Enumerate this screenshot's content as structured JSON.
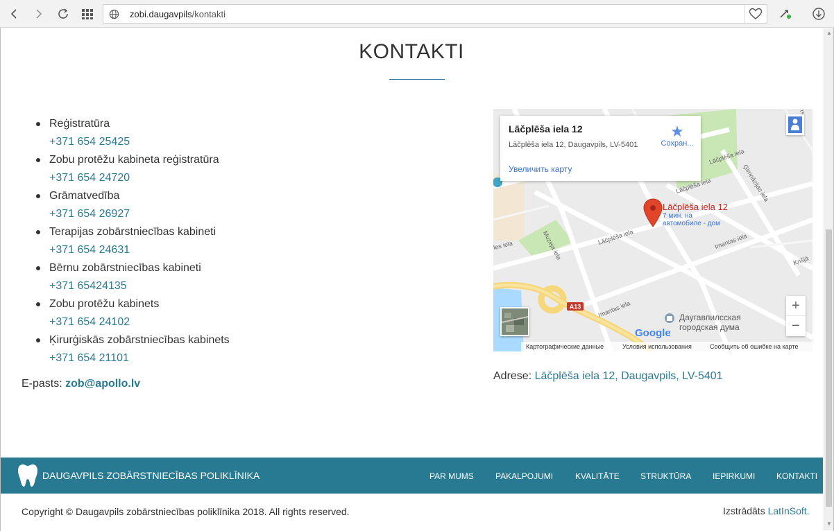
{
  "browser": {
    "url_host": "zobi.daugavpils",
    "url_path": "/kontakti",
    "icons": [
      "back-icon",
      "forward-icon",
      "reload-icon",
      "apps-grid-icon",
      "globe-icon",
      "heart-icon",
      "extension-icon",
      "download-icon"
    ]
  },
  "page": {
    "title": "KONTAKTI"
  },
  "contacts": [
    {
      "label": "Reģistratūra",
      "phone": "+371 654 25425"
    },
    {
      "label": "Zobu protēžu kabineta reģistratūra",
      "phone": "+371 654 24720"
    },
    {
      "label": "Grāmatvedība",
      "phone": "+371 654 26927"
    },
    {
      "label": "Terapijas zobārstniecības kabineti",
      "phone": "+371 654 24631"
    },
    {
      "label": "Bērnu zobārstniecības kabineti",
      "phone": "+371 65424135"
    },
    {
      "label": "Zobu protēžu kabinets",
      "phone": "+371 654 24102"
    },
    {
      "label": "Ķirurģiskās zobārstniecības kabinets",
      "phone": "+371 654 21101"
    }
  ],
  "email": {
    "label": "E-pasts:",
    "value": "zob@apollo.lv"
  },
  "map": {
    "card_title": "Lāčplēša iela 12",
    "card_address": "Lāčplēša iela 12, Daugavpils, LV-5401",
    "card_link": "Увеличить карту",
    "save_label": "Сохран...",
    "pin_label": "Lāčplēša iela 12",
    "pin_sub_1": "7 мин. на",
    "pin_sub_2": "автомобиле - дом",
    "landmark_1": "Даугавпилсская",
    "landmark_2": "городская дума",
    "road_badge": "A13",
    "google": "Google",
    "footer_data": "Картографические данные",
    "footer_terms": "Условия использования",
    "footer_report": "Сообщить об ошибке на карте",
    "zoom_in": "+",
    "zoom_out": "−",
    "streets": {
      "lacplesa_a": "Lāčplēša iela",
      "lacplesa_b": "Lāčplēša iela",
      "lacplesa_c": "Lāčplēša iela",
      "gimnazijas": "Ģimnāzijas iela",
      "muzeja": "Muzeja iela",
      "imantas_a": "Imantas iela",
      "imantas_b": "Imantas iela",
      "krisjana": "Krišjā",
      "iela_left": "les iela",
      "rs": "rs"
    }
  },
  "address": {
    "label": "Adrese:",
    "value": "Lāčplēša iela 12, Daugavpils, LV-5401"
  },
  "footer": {
    "brand": "DAUGAVPILS ZOBĀRSTNIECĪBAS POLIKLĪNIKA",
    "nav": [
      "PAR MUMS",
      "PAKALPOJUMI",
      "KVALITĀTE",
      "STRUKTŪRA",
      "IEPIRKUMI",
      "KONTAKTI"
    ],
    "copyright": "Copyright © Daugavpils zobārstniecības poliklīnika 2018. All rights reserved.",
    "credit_label": "Izstrādāts",
    "credit_link": "LatInSoft."
  },
  "colors": {
    "accent": "#277a91",
    "link": "#2a7a94"
  }
}
